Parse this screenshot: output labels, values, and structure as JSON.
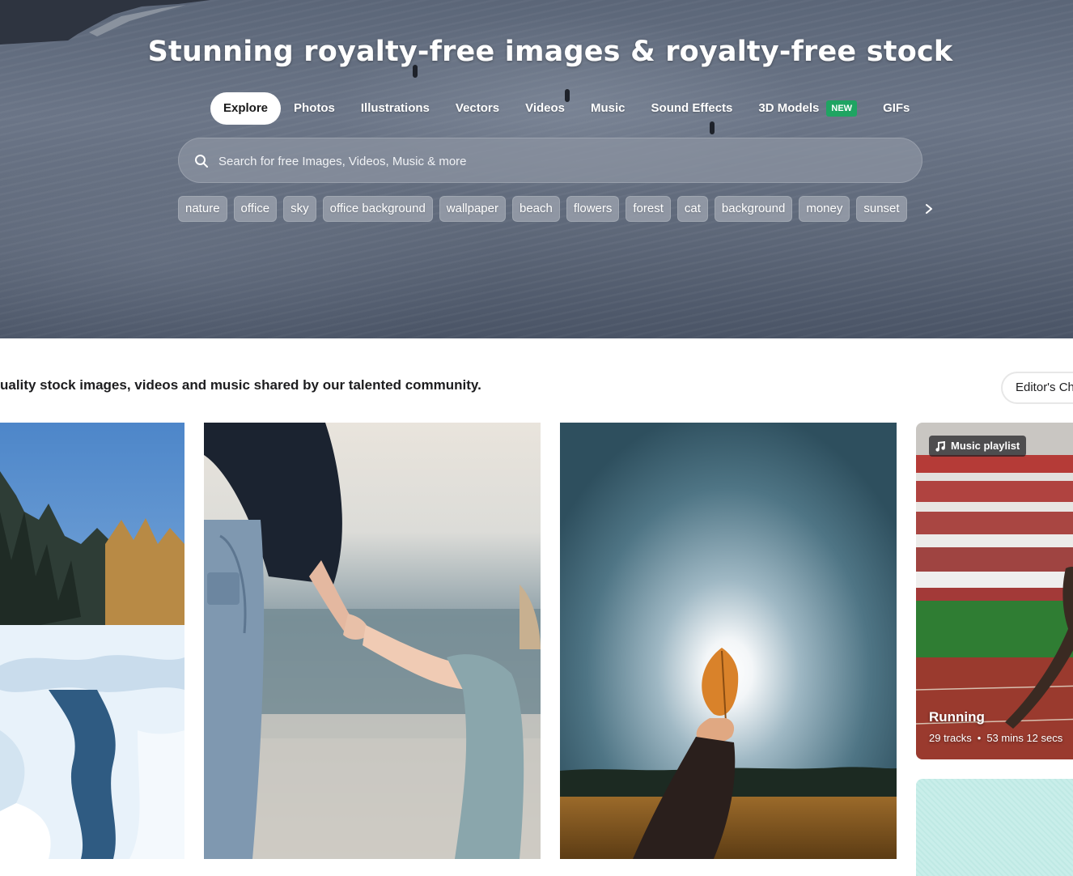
{
  "hero": {
    "title": "Stunning royalty-free images & royalty-free stock",
    "tabs": [
      {
        "label": "Explore",
        "active": true
      },
      {
        "label": "Photos"
      },
      {
        "label": "Illustrations"
      },
      {
        "label": "Vectors"
      },
      {
        "label": "Videos"
      },
      {
        "label": "Music"
      },
      {
        "label": "Sound Effects"
      },
      {
        "label": "3D Models",
        "badge": "NEW"
      },
      {
        "label": "GIFs"
      }
    ],
    "search": {
      "placeholder": "Search for free Images, Videos, Music & more",
      "value": "",
      "icon": "search-icon"
    },
    "chips": [
      "nature",
      "office",
      "sky",
      "office background",
      "wallpaper",
      "beach",
      "flowers",
      "forest",
      "cat",
      "background",
      "money",
      "sunset"
    ],
    "chips_next_icon": "chevron-right-icon"
  },
  "main": {
    "tagline": "uality stock images, videos and music shared by our talented community.",
    "editors_choice_label": "Editor's Ch",
    "cards": [
      {
        "subject": "frozen river in snowy forest"
      },
      {
        "subject": "adult holding child's hand by the sea"
      },
      {
        "subject": "hand holding autumn leaf against sky"
      },
      {
        "type": "music-playlist",
        "badge": "Music playlist",
        "title": "Running",
        "tracks": "29 tracks",
        "separator": "•",
        "duration": "53 mins 12 secs"
      },
      {
        "subject": "mint patterned image"
      }
    ]
  },
  "colors": {
    "hero_bg": "#5b6678",
    "new_badge": "#1fa462",
    "chip_bg": "#9ca3ae",
    "text_dark": "#1d1d1f"
  }
}
